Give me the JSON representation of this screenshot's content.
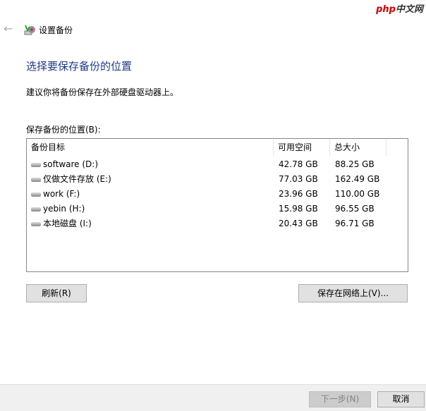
{
  "window": {
    "title": "设置备份",
    "watermark": "php中文网"
  },
  "heading": "选择要保存备份的位置",
  "subtitle": "建议你将备份保存在外部硬盘驱动器上。",
  "location_label": "保存备份的位置(B):",
  "columns": [
    "备份目标",
    "可用空间",
    "总大小"
  ],
  "rows": [
    {
      "name": "software (D:)",
      "free": "42.78 GB",
      "total": "88.25 GB"
    },
    {
      "name": "仅做文件存放 (E:)",
      "free": "77.03 GB",
      "total": "162.49 GB"
    },
    {
      "name": "work (F:)",
      "free": "23.96 GB",
      "total": "110.00 GB"
    },
    {
      "name": "yebin (H:)",
      "free": "15.98 GB",
      "total": "96.55 GB"
    },
    {
      "name": "本地磁盘 (I:)",
      "free": "20.43 GB",
      "total": "96.71 GB"
    }
  ],
  "buttons": {
    "refresh": "刷新(R)",
    "network": "保存在网络上(V)...",
    "next": "下一步(N)",
    "cancel": "取消"
  }
}
